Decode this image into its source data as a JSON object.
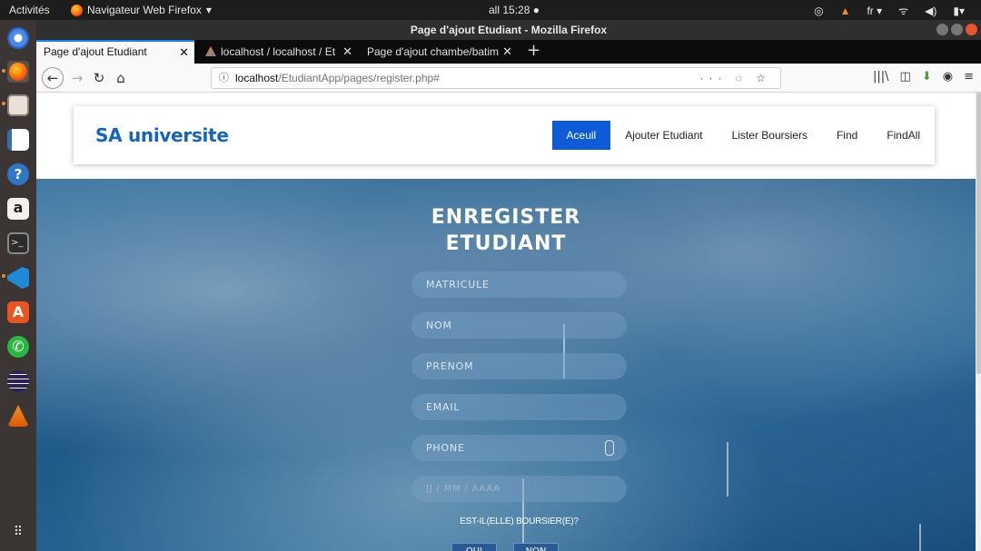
{
  "system": {
    "activities": "Activités",
    "app_name": "Navigateur Web Firefox",
    "clock": "all 15:28 ●",
    "lang": "fr"
  },
  "window": {
    "title": "Page d'ajout Etudiant - Mozilla Firefox"
  },
  "tabs": [
    {
      "label": "Page d'ajout Etudiant",
      "active": true
    },
    {
      "label": "localhost / localhost / Et",
      "active": false
    },
    {
      "label": "Page d'ajout chambe/batim",
      "active": false
    }
  ],
  "url": {
    "host": "localhost",
    "path": "/EtudiantApp/pages/register.php#",
    "actions": "··· ◌ ☆"
  },
  "site": {
    "brand": "SA universite",
    "menu": [
      "Aceuil",
      "Ajouter Etudiant",
      "Lister Boursiers",
      "Find",
      "FindAll"
    ],
    "active_menu": "Aceuil"
  },
  "form": {
    "title_line1": "ENREGISTER",
    "title_line2": "ETUDIANT",
    "fields": [
      "MATRICULE",
      "NOM",
      "PRENOM",
      "EMAIL",
      "PHONE"
    ],
    "date_placeholder": "JJ / MM / AAAA",
    "question": "EST-IL(ELLE) BOURSIER(E)?",
    "options": [
      "OUI",
      "NON"
    ]
  },
  "colors": {
    "accent": "#0d5bd6",
    "brand": "#1565c0"
  }
}
